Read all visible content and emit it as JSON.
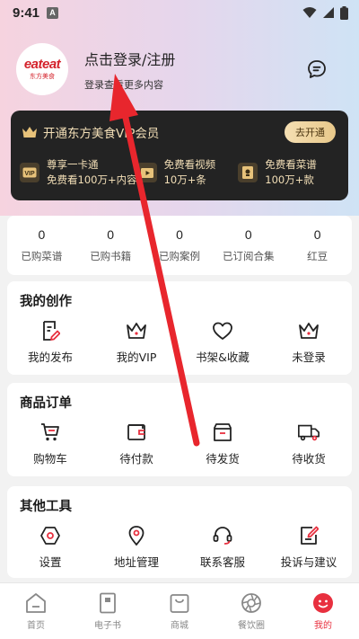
{
  "status_bar": {
    "time": "9:41",
    "badge": "A"
  },
  "profile": {
    "logo_text": "eateat",
    "logo_subtext": "东方美食",
    "login_title": "点击登录/注册",
    "login_subtitle": "登录查看更多内容"
  },
  "vip": {
    "title": "开通东方美食VIP会员",
    "open_button": "去开通",
    "features": [
      {
        "icon": "vip-badge-icon",
        "line1": "尊享一卡通",
        "line2": "免费看100万+内容"
      },
      {
        "icon": "video-icon",
        "line1": "免费看视频",
        "line2": "10万+条"
      },
      {
        "icon": "recipe-icon",
        "line1": "免费看菜谱",
        "line2": "100万+款"
      }
    ]
  },
  "stats": [
    {
      "value": "0",
      "label": "已购菜谱"
    },
    {
      "value": "0",
      "label": "已购书籍"
    },
    {
      "value": "0",
      "label": "已购案例"
    },
    {
      "value": "0",
      "label": "已订阅合集"
    },
    {
      "value": "0",
      "label": "红豆"
    }
  ],
  "creation": {
    "title": "我的创作",
    "items": [
      {
        "icon": "edit-document-icon",
        "label": "我的发布"
      },
      {
        "icon": "crown-icon",
        "label": "我的VIP"
      },
      {
        "icon": "heart-icon",
        "label": "书架&收藏"
      },
      {
        "icon": "crown-icon",
        "label": "未登录"
      }
    ]
  },
  "orders": {
    "title": "商品订单",
    "items": [
      {
        "icon": "cart-icon",
        "label": "购物车"
      },
      {
        "icon": "wallet-icon",
        "label": "待付款"
      },
      {
        "icon": "box-icon",
        "label": "待发货"
      },
      {
        "icon": "truck-icon",
        "label": "待收货"
      }
    ]
  },
  "tools": {
    "title": "其他工具",
    "items": [
      {
        "icon": "settings-icon",
        "label": "设置"
      },
      {
        "icon": "location-icon",
        "label": "地址管理"
      },
      {
        "icon": "headset-icon",
        "label": "联系客服"
      },
      {
        "icon": "feedback-icon",
        "label": "投诉与建议"
      }
    ]
  },
  "tabbar": [
    {
      "icon": "home-icon",
      "label": "首页"
    },
    {
      "icon": "ebook-icon",
      "label": "电子书"
    },
    {
      "icon": "shop-icon",
      "label": "商城"
    },
    {
      "icon": "camera-aperture-icon",
      "label": "餐饮圈"
    },
    {
      "icon": "profile-icon",
      "label": "我的",
      "active": true
    }
  ],
  "colors": {
    "accent": "#e8303f",
    "vip_gold": "#f3dfb7",
    "vip_dark": "#232323",
    "annotation_arrow": "#e8262d"
  }
}
